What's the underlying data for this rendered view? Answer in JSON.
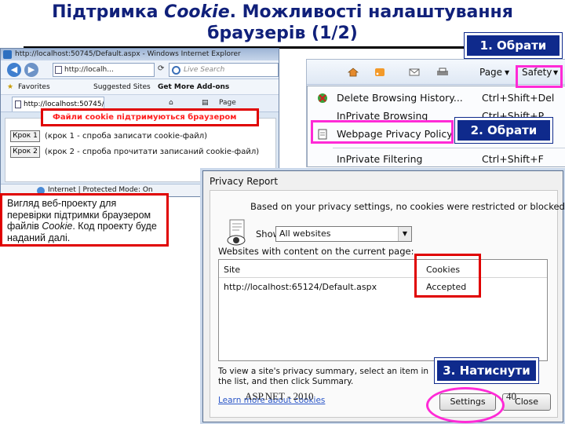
{
  "slide": {
    "title_prefix": "Підтримка ",
    "title_italic": "Cookie",
    "title_line1_suffix": ". Можливості налаштування",
    "title_line2": "браузерів (1/2)",
    "footer": "ASP.NET - 2010",
    "page_number": "40"
  },
  "callouts": {
    "step1": "1. Обрати",
    "step2": "2. Обрати",
    "step3": "3. Натиснути"
  },
  "note": {
    "text_before": "   Вигляд веб-проекту для перевірки підтримки браузером файлів ",
    "italic": "Cookie",
    "text_after": ". Код проекту буде наданий далі."
  },
  "ie_window": {
    "title": "http://localhost:50745/Default.aspx - Windows Internet Explorer",
    "address": "http://localh...",
    "search_placeholder": "Live Search",
    "favorites": "Favorites",
    "suggested": "Suggested Sites",
    "addons": "Get More Add-ons",
    "tab_title": "http://localhost:50745/...",
    "page_menu": "Page",
    "steps": [
      {
        "button": "Крок 1",
        "text": "(крок 1 - спроба записати cookie-файл)"
      },
      {
        "button": "Крок 2",
        "text": "(крок 2 - спроба прочитати записаний cookie-файл)"
      }
    ],
    "result": "Файли cookie підтримуються браузером",
    "status": "Internet | Protected Mode: On"
  },
  "toolbar": {
    "page_label": "Page",
    "safety_label": "Safety"
  },
  "safety_menu": [
    {
      "label": "Delete Browsing History...",
      "shortcut": "Ctrl+Shift+Del"
    },
    {
      "label": "InPrivate Browsing",
      "shortcut": "Ctrl+Shift+P"
    },
    {
      "label": "Webpage Privacy Policy...",
      "shortcut": ""
    },
    {
      "label": "InPrivate Filtering",
      "shortcut": "Ctrl+Shift+F"
    }
  ],
  "privacy_dialog": {
    "title": "Privacy Report",
    "message": "Based on your privacy settings, no cookies were restricted or blocked.",
    "show_label": "Show:",
    "show_value": "All websites",
    "sites_label": "Websites with content on the current page:",
    "columns": [
      "Site",
      "Cookies"
    ],
    "rows": [
      {
        "site": "http://localhost:65124/Default.aspx",
        "cookies": "Accepted"
      }
    ],
    "summary_text": "To view a site's privacy summary, select an item in the list, and then click Summary.",
    "learn_more": "Learn more about cookies",
    "settings_button": "Settings",
    "close_button": "Close"
  },
  "colors": {
    "title": "#10207a",
    "callout_bg": "#0f2a8c",
    "highlight_red": "#e00000",
    "highlight_magenta": "#ff2ad6"
  }
}
